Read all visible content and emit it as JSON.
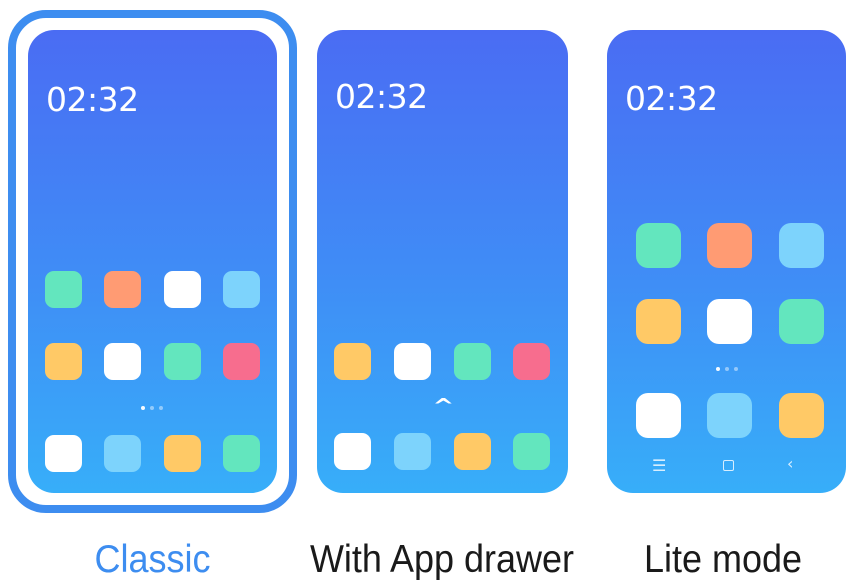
{
  "options": [
    {
      "label": "Classic",
      "clock": "02:32",
      "selected": true,
      "label_color": "#3d8df0"
    },
    {
      "label": "With App drawer",
      "clock": "02:32",
      "selected": false,
      "label_color": "#1a1a1a"
    },
    {
      "label": "Lite mode",
      "clock": "02:32",
      "selected": false,
      "label_color": "#1a1a1a"
    }
  ],
  "colors": {
    "green": "#63e6be",
    "orange": "#ff9b73",
    "white": "#ffffff",
    "lightblue": "#7dd3fc",
    "yellow": "#ffc966",
    "pink": "#f76d8e",
    "accent": "#3d8df0"
  },
  "icons": {
    "app_drawer_toggle": "chevron-up-icon",
    "nav_menu": "menu-icon",
    "nav_home": "home-square-icon",
    "nav_back": "back-chevron-icon"
  }
}
